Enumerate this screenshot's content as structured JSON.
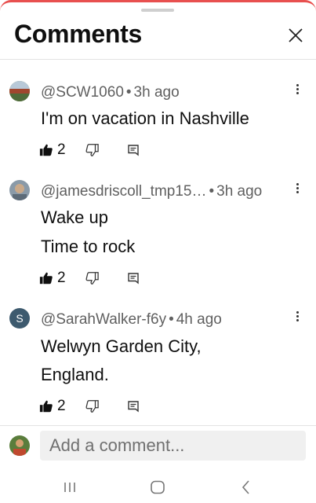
{
  "header": {
    "title": "Comments"
  },
  "comments": [
    {
      "author": "@SCW1060",
      "time": "3h ago",
      "lines": [
        "I'm on vacation in Nashville"
      ],
      "likes": "2",
      "avatar": "photo-landscape"
    },
    {
      "author": "@jamesdriscoll_tmp15…",
      "time": "3h ago",
      "lines": [
        "Wake up",
        "Time to rock"
      ],
      "likes": "2",
      "avatar": "photo-portrait"
    },
    {
      "author": "@SarahWalker-f6y",
      "time": "4h ago",
      "lines": [
        "Welwyn Garden City,",
        "England."
      ],
      "likes": "2",
      "avatar_letter": "S",
      "avatar_color": "#3d5a6e"
    }
  ],
  "composer": {
    "placeholder": "Add a comment..."
  },
  "colors": {
    "accent_top": "#e8504f",
    "meta": "#606060",
    "input_bg": "#f0f0f0"
  }
}
